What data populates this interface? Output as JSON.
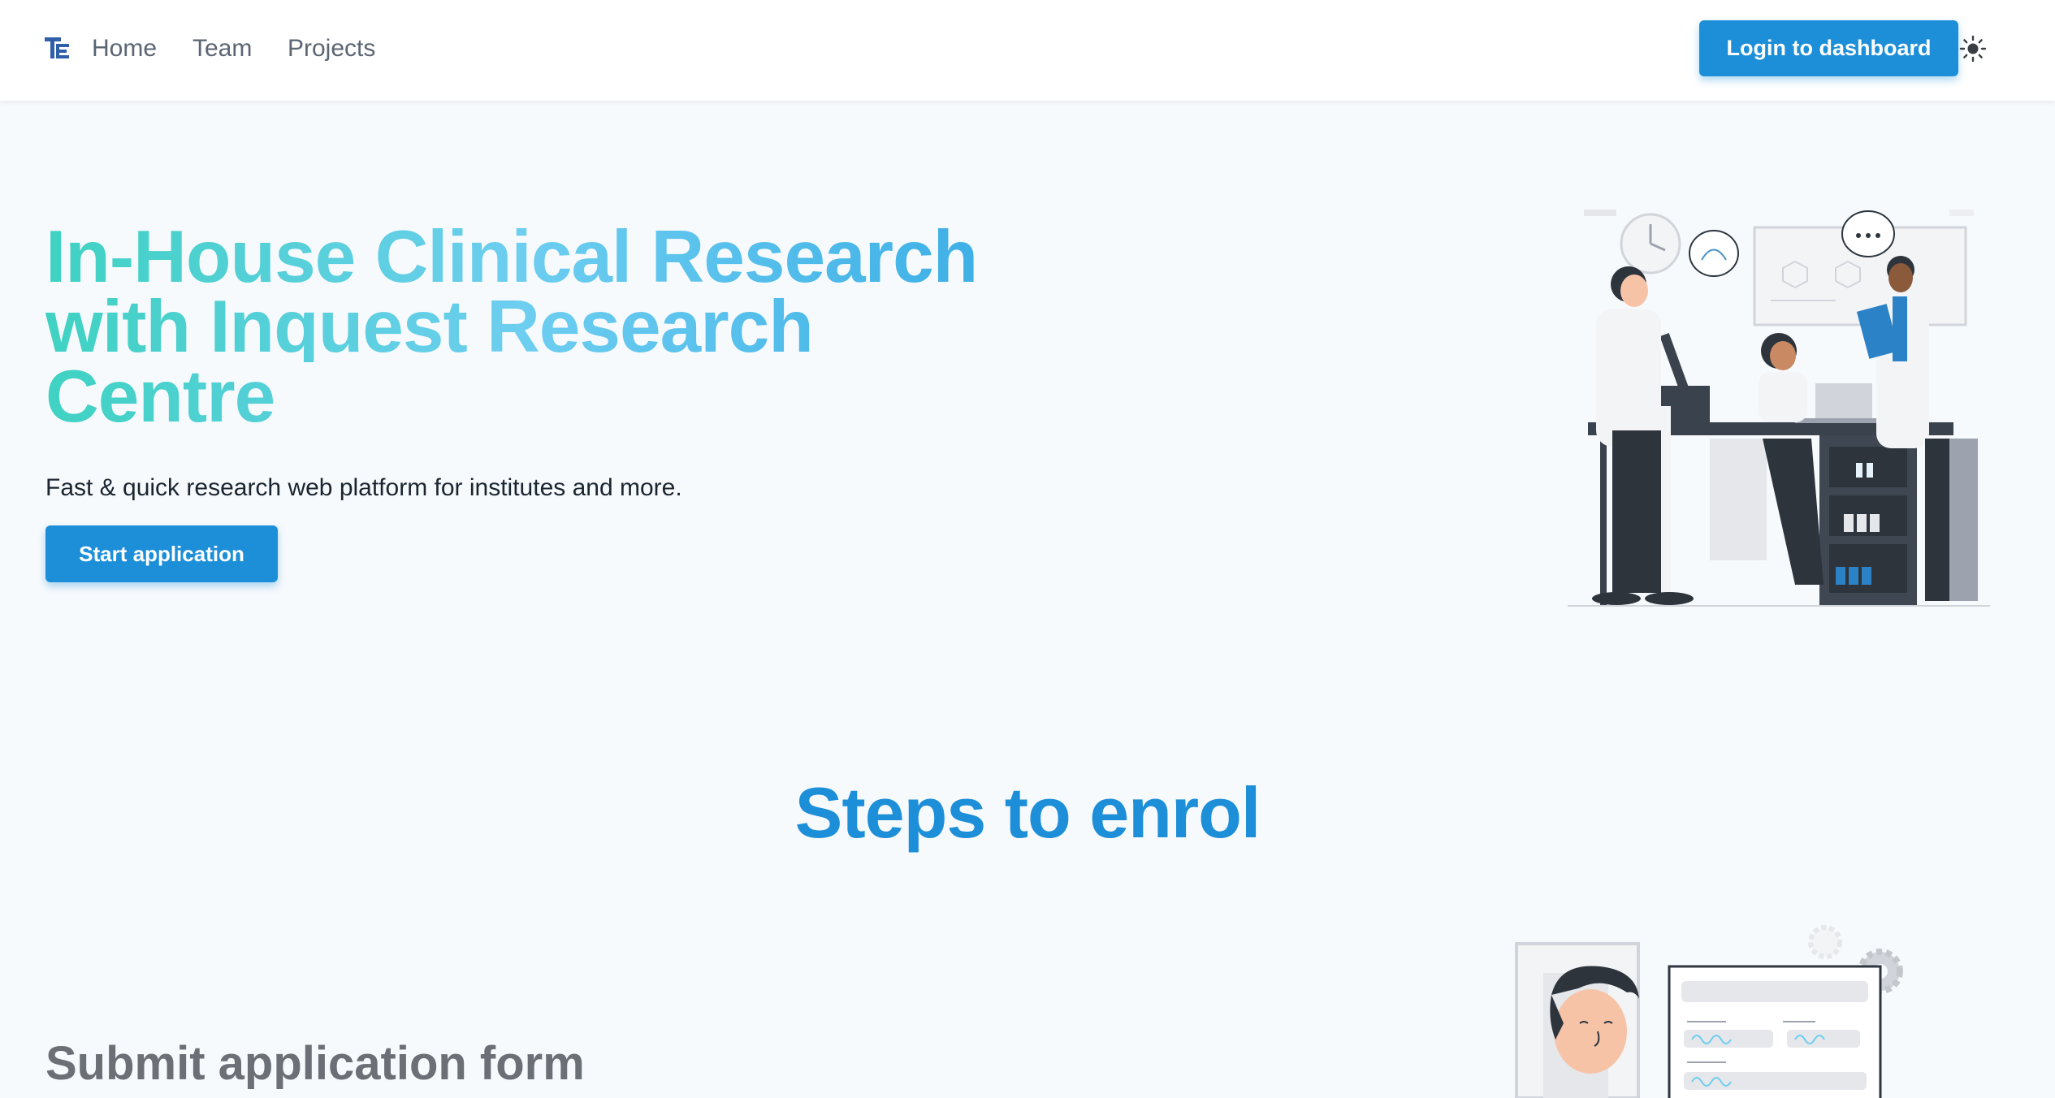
{
  "nav": {
    "links": [
      "Home",
      "Team",
      "Projects"
    ],
    "login_label": "Login to dashboard",
    "theme_icon": "sun-icon"
  },
  "hero": {
    "title_line1": "In-House Clinical Research",
    "title_line2": "with Inquest Research",
    "title_line3": "Centre",
    "subtitle": "Fast & quick research web platform for institutes and more.",
    "cta_label": "Start application"
  },
  "steps": {
    "heading": "Steps to enrol",
    "step1_title": "Submit application form"
  },
  "colors": {
    "accent": "#1d8fd8",
    "gradient_start": "#3fd2c2",
    "gradient_end": "#32a8e4",
    "background": "#f7fafd"
  }
}
